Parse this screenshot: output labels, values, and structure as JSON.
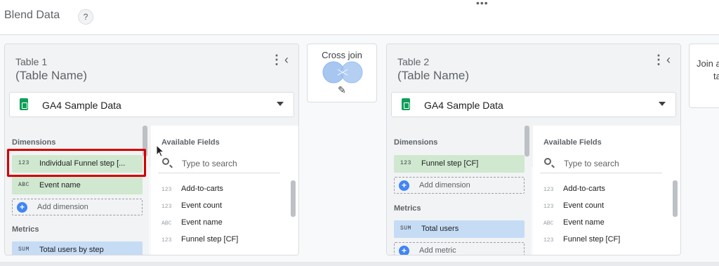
{
  "header": {
    "title": "Blend Data",
    "help_glyph": "?"
  },
  "join_config": {
    "label": "Cross join",
    "edit_icon": "pencil-icon"
  },
  "next_join": {
    "label_line1": "Join a",
    "label_line2": "ta"
  },
  "tables": [
    {
      "label": "Table 1",
      "name": "(Table Name)",
      "source": "GA4 Sample Data",
      "dimensions_title": "Dimensions",
      "dimensions": [
        {
          "type": "123",
          "name": "Individual Funnel step [..."
        },
        {
          "type": "ABC",
          "name": "Event name"
        }
      ],
      "add_dimension": "Add dimension",
      "metrics_title": "Metrics",
      "metrics": [
        {
          "type": "SUM",
          "name": "Total users by step"
        }
      ],
      "available_fields_title": "Available Fields",
      "search_placeholder": "Type to search",
      "fields": [
        {
          "type": "123",
          "name": "Add-to-carts"
        },
        {
          "type": "123",
          "name": "Event count"
        },
        {
          "type": "ABC",
          "name": "Event name"
        },
        {
          "type": "123",
          "name": "Funnel step [CF]"
        }
      ]
    },
    {
      "label": "Table 2",
      "name": "(Table Name)",
      "source": "GA4 Sample Data",
      "dimensions_title": "Dimensions",
      "dimensions": [
        {
          "type": "123",
          "name": "Funnel step [CF]"
        }
      ],
      "add_dimension": "Add dimension",
      "metrics_title": "Metrics",
      "metrics": [
        {
          "type": "SUM",
          "name": "Total users"
        }
      ],
      "add_metric": "Add metric",
      "available_fields_title": "Available Fields",
      "search_placeholder": "Type to search",
      "fields": [
        {
          "type": "123",
          "name": "Add-to-carts"
        },
        {
          "type": "123",
          "name": "Event count"
        },
        {
          "type": "ABC",
          "name": "Event name"
        },
        {
          "type": "123",
          "name": "Funnel step [CF]"
        }
      ]
    }
  ],
  "colors": {
    "dimension_chip": "#cfe8cf",
    "metric_chip": "#c6dcf5",
    "highlight_border": "#d50000",
    "sheets_green": "#0f9d58",
    "add_blue": "#4285f4"
  }
}
